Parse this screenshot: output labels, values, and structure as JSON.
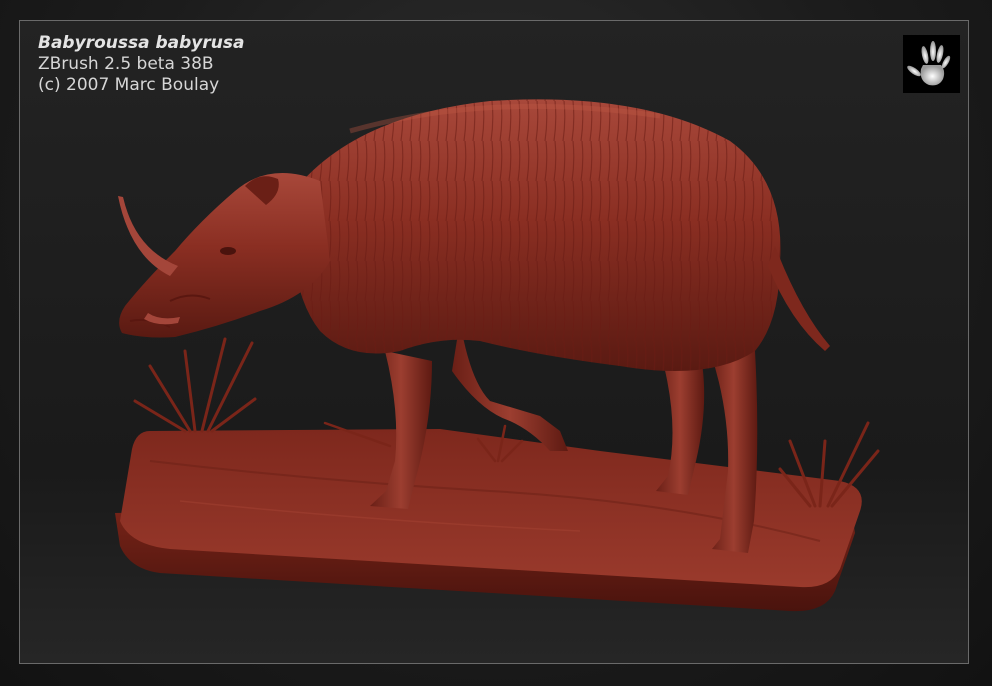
{
  "caption": {
    "title": "Babyroussa babyrusa",
    "software": "ZBrush 2.5 beta 38B",
    "copyright": "(c) 2007 Marc Boulay"
  },
  "icons": {
    "logo": "handprint-logo-icon"
  },
  "colors": {
    "background": "#1c1c1c",
    "frame_border": "#6a6a6a",
    "clay": "#8a2e22",
    "clay_highlight": "#b5503d",
    "clay_shadow": "#4a1510",
    "text": "#d6d6d6"
  }
}
